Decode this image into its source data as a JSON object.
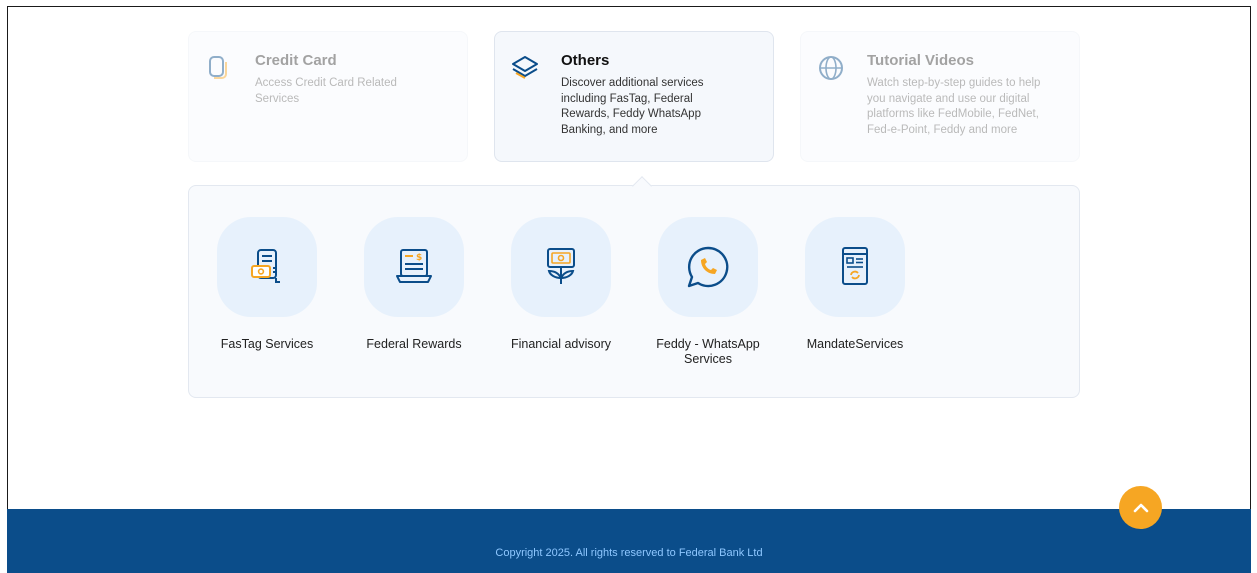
{
  "cards": [
    {
      "title": "Credit Card",
      "desc": "Access Credit Card Related Services"
    },
    {
      "title": "Others",
      "desc": "Discover additional services including FasTag, Federal Rewards, Feddy WhatsApp Banking, and more"
    },
    {
      "title": "Tutorial Videos",
      "desc": "Watch step-by-step guides to help you navigate and use our digital platforms like FedMobile, FedNet, Fed-e-Point, Feddy and more"
    }
  ],
  "services": [
    {
      "label": "FasTag Services",
      "icon": "fastag-icon"
    },
    {
      "label": "Federal Rewards",
      "icon": "rewards-icon"
    },
    {
      "label": "Financial advisory",
      "icon": "advisory-icon"
    },
    {
      "label": "Feddy - WhatsApp Services",
      "icon": "whatsapp-icon"
    },
    {
      "label": "MandateServices",
      "icon": "mandate-icon"
    }
  ],
  "footer": {
    "copyright": "Copyright 2025. All rights reserved to Federal Bank Ltd"
  },
  "colors": {
    "accent": "#f6a623",
    "brand": "#0b4d8a",
    "icon_blue": "#0b4d8a"
  }
}
